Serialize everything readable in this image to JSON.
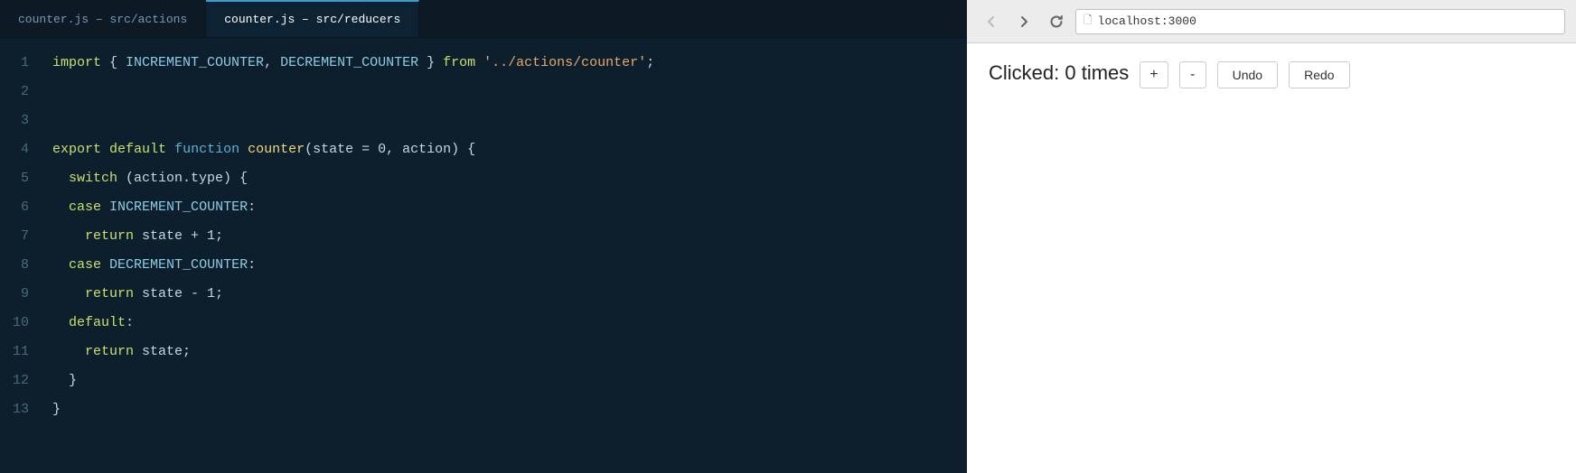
{
  "editor": {
    "tabs": [
      {
        "label": "counter.js – src/actions",
        "active": false
      },
      {
        "label": "counter.js – src/reducers",
        "active": true
      }
    ],
    "lines": [
      {
        "number": 1,
        "tokens": [
          {
            "text": "import",
            "class": "kw-import"
          },
          {
            "text": " { ",
            "class": "punct"
          },
          {
            "text": "INCREMENT_COUNTER",
            "class": "const-name"
          },
          {
            "text": ", ",
            "class": "punct"
          },
          {
            "text": "DECREMENT_COUNTER",
            "class": "const-name"
          },
          {
            "text": " } ",
            "class": "punct"
          },
          {
            "text": "from",
            "class": "kw-from"
          },
          {
            "text": " ",
            "class": "plain"
          },
          {
            "text": "'../actions/counter'",
            "class": "str"
          },
          {
            "text": ";",
            "class": "punct"
          }
        ]
      },
      {
        "number": 2,
        "tokens": []
      },
      {
        "number": 3,
        "tokens": []
      },
      {
        "number": 4,
        "tokens": [
          {
            "text": "export",
            "class": "kw-export"
          },
          {
            "text": " ",
            "class": "plain"
          },
          {
            "text": "default",
            "class": "kw-default"
          },
          {
            "text": " ",
            "class": "plain"
          },
          {
            "text": "function",
            "class": "kw-function"
          },
          {
            "text": " ",
            "class": "plain"
          },
          {
            "text": "counter",
            "class": "fn-name"
          },
          {
            "text": "(state = 0, action) {",
            "class": "plain"
          }
        ]
      },
      {
        "number": 5,
        "tokens": [
          {
            "text": "  ",
            "class": "plain"
          },
          {
            "text": "switch",
            "class": "kw-switch"
          },
          {
            "text": " (action.type) {",
            "class": "plain"
          }
        ]
      },
      {
        "number": 6,
        "tokens": [
          {
            "text": "  ",
            "class": "plain"
          },
          {
            "text": "case",
            "class": "kw-case"
          },
          {
            "text": " ",
            "class": "plain"
          },
          {
            "text": "INCREMENT_COUNTER",
            "class": "const-name"
          },
          {
            "text": ":",
            "class": "plain"
          }
        ]
      },
      {
        "number": 7,
        "tokens": [
          {
            "text": "    ",
            "class": "plain"
          },
          {
            "text": "return",
            "class": "kw-return"
          },
          {
            "text": " state + 1;",
            "class": "plain"
          }
        ]
      },
      {
        "number": 8,
        "tokens": [
          {
            "text": "  ",
            "class": "plain"
          },
          {
            "text": "case",
            "class": "kw-case"
          },
          {
            "text": " ",
            "class": "plain"
          },
          {
            "text": "DECREMENT_COUNTER",
            "class": "const-name"
          },
          {
            "text": ":",
            "class": "plain"
          }
        ]
      },
      {
        "number": 9,
        "tokens": [
          {
            "text": "    ",
            "class": "plain"
          },
          {
            "text": "return",
            "class": "kw-return"
          },
          {
            "text": " state - 1;",
            "class": "plain"
          }
        ]
      },
      {
        "number": 10,
        "tokens": [
          {
            "text": "  ",
            "class": "plain"
          },
          {
            "text": "default",
            "class": "kw-default-label"
          },
          {
            "text": ":",
            "class": "plain"
          }
        ]
      },
      {
        "number": 11,
        "tokens": [
          {
            "text": "    ",
            "class": "plain"
          },
          {
            "text": "return",
            "class": "kw-return"
          },
          {
            "text": " state;",
            "class": "plain"
          }
        ]
      },
      {
        "number": 12,
        "tokens": [
          {
            "text": "  }",
            "class": "brace"
          }
        ]
      },
      {
        "number": 13,
        "tokens": [
          {
            "text": "}",
            "class": "brace"
          }
        ]
      }
    ]
  },
  "browser": {
    "back_label": "←",
    "forward_label": "→",
    "refresh_label": "↻",
    "address": "localhost:3000",
    "clicked_text": "Clicked: 0 times",
    "increment_label": "+",
    "decrement_label": "-",
    "undo_label": "Undo",
    "redo_label": "Redo"
  }
}
